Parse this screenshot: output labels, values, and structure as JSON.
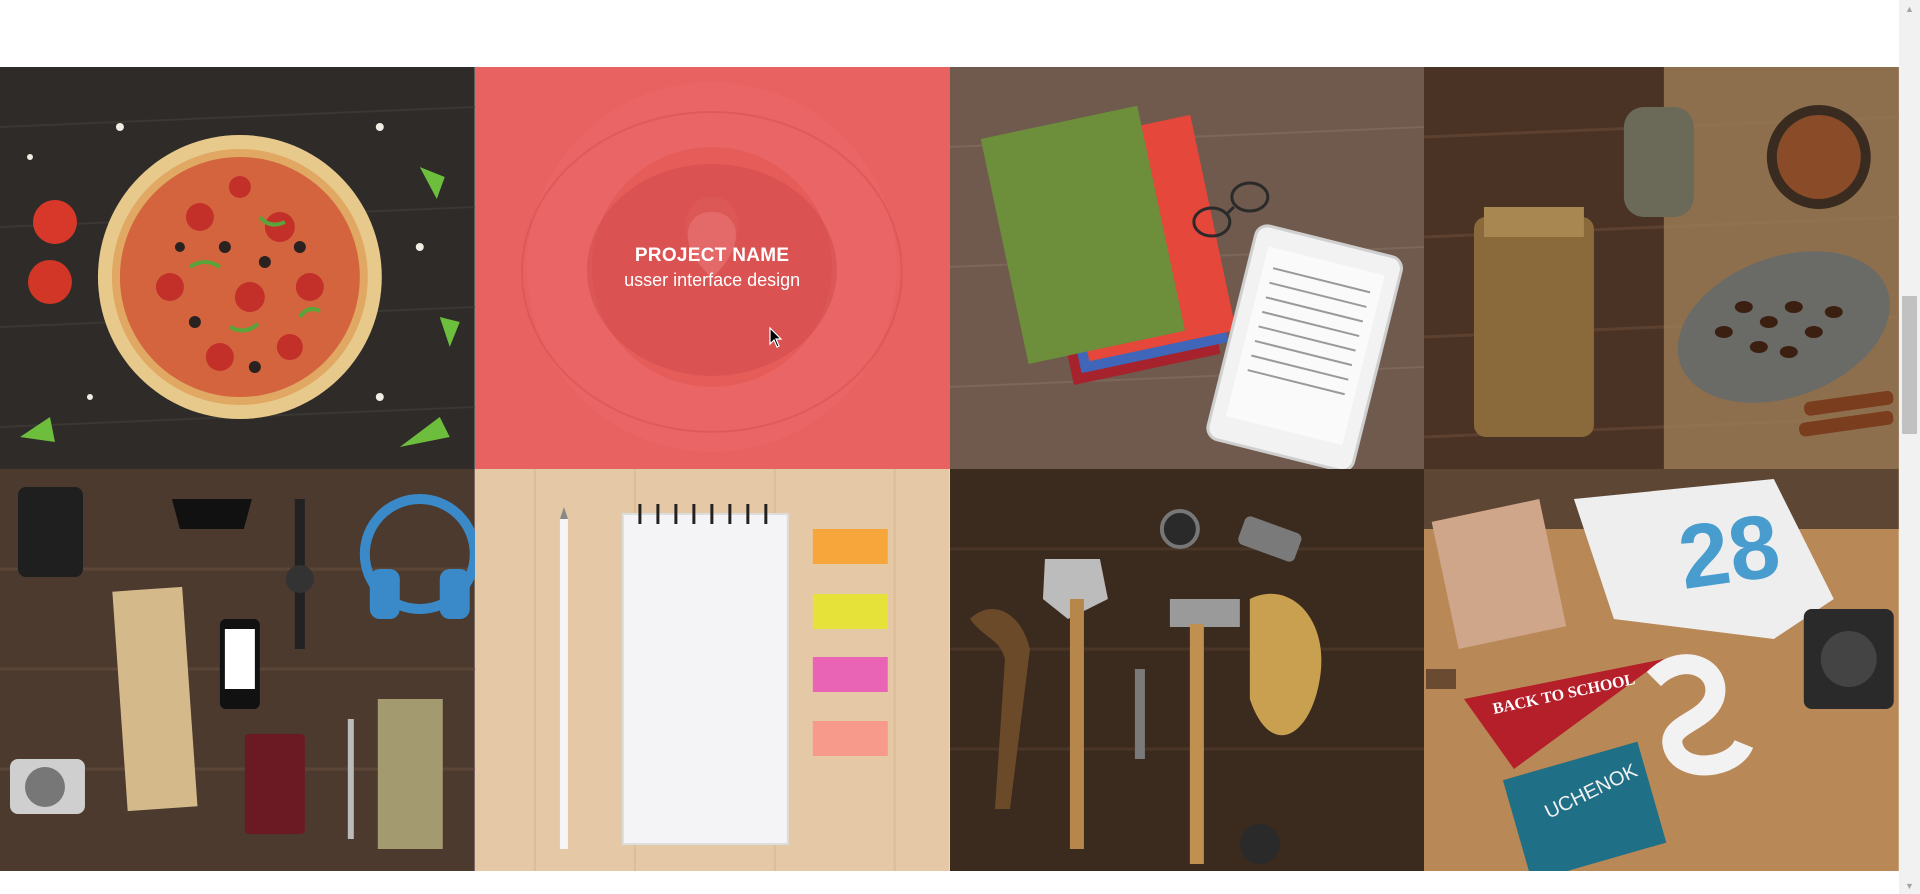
{
  "portfolio": {
    "tiles": [
      {
        "subject": "pizza"
      },
      {
        "subject": "latte-art",
        "hovered": true,
        "overlay_color": "#e95a5a",
        "project_name": "PROJECT NAME",
        "project_category": "usser interface design"
      },
      {
        "subject": "books-and-ereader"
      },
      {
        "subject": "coffee-beans-and-grinder"
      },
      {
        "subject": "travel-flatlay"
      },
      {
        "subject": "notepad-and-sticky-notes"
      },
      {
        "subject": "vintage-tools"
      },
      {
        "subject": "back-to-school-desk",
        "pennant_text": "BACK TO SCHOOL",
        "tshirt_text": "28",
        "book_text": "UCHENOK"
      }
    ]
  },
  "colors": {
    "accent": "#e95a5a",
    "page_bg": "#ffffff"
  },
  "icons": {
    "scroll_up": "triangle-up-icon",
    "scroll_down": "triangle-down-icon",
    "cursor": "mouse-pointer-icon"
  }
}
